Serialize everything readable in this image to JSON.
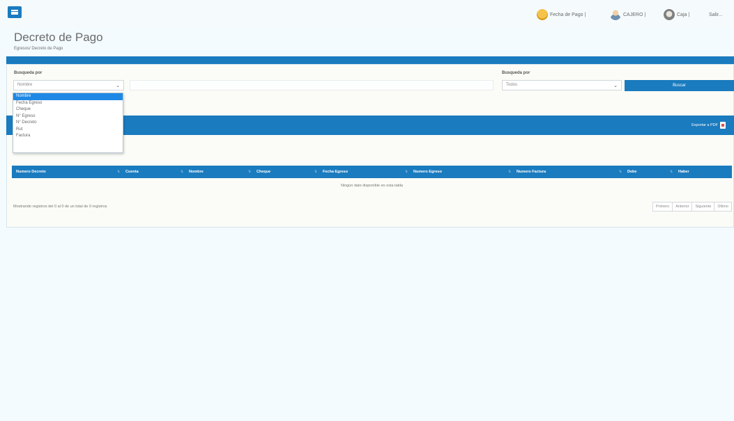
{
  "topbar": {
    "items": [
      {
        "label": "Fecha de Pago |"
      },
      {
        "label": "CAJERO |"
      },
      {
        "label": "Caja |"
      },
      {
        "label": "Salir..."
      }
    ]
  },
  "page": {
    "title": "Decreto de Pago",
    "breadcrumb": "Egresos/ Decreto de Pago"
  },
  "search": {
    "label_left": "Busqueda por",
    "select_left_value": "Nombre",
    "label_right": "Busqueda por",
    "select_right_value": "Todos",
    "button_label": "Buscar",
    "options": [
      "Nombre",
      "Fecha Egreso",
      "Cheque",
      "N° Egreso",
      "N° Decreto",
      "Rut",
      "Factura"
    ]
  },
  "section": {
    "export_label": "Exportar a PDF"
  },
  "table": {
    "columns": [
      "Numero Decreto",
      "Cuenta",
      "Nombre",
      "Cheque",
      "Fecha Egreso",
      "Numero Egreso",
      "Numero Factura",
      "Debe",
      "Haber"
    ],
    "empty_message": "Ningún dato disponible en esta tabla",
    "info": "Mostrando registros del 0 al 0 de un total de 0 registros"
  },
  "pagination": {
    "first": "Primero",
    "previous": "Anterior",
    "next": "Siguiente",
    "last": "Último"
  },
  "colors": {
    "primary": "#1a7bbf",
    "selected_option": "#1e88e5",
    "background": "#f3fbfe"
  },
  "icons": [
    "menu-icon",
    "calendar-icon",
    "user-icon",
    "cashier-icon",
    "pdf-icon",
    "chevron-down-icon"
  ]
}
